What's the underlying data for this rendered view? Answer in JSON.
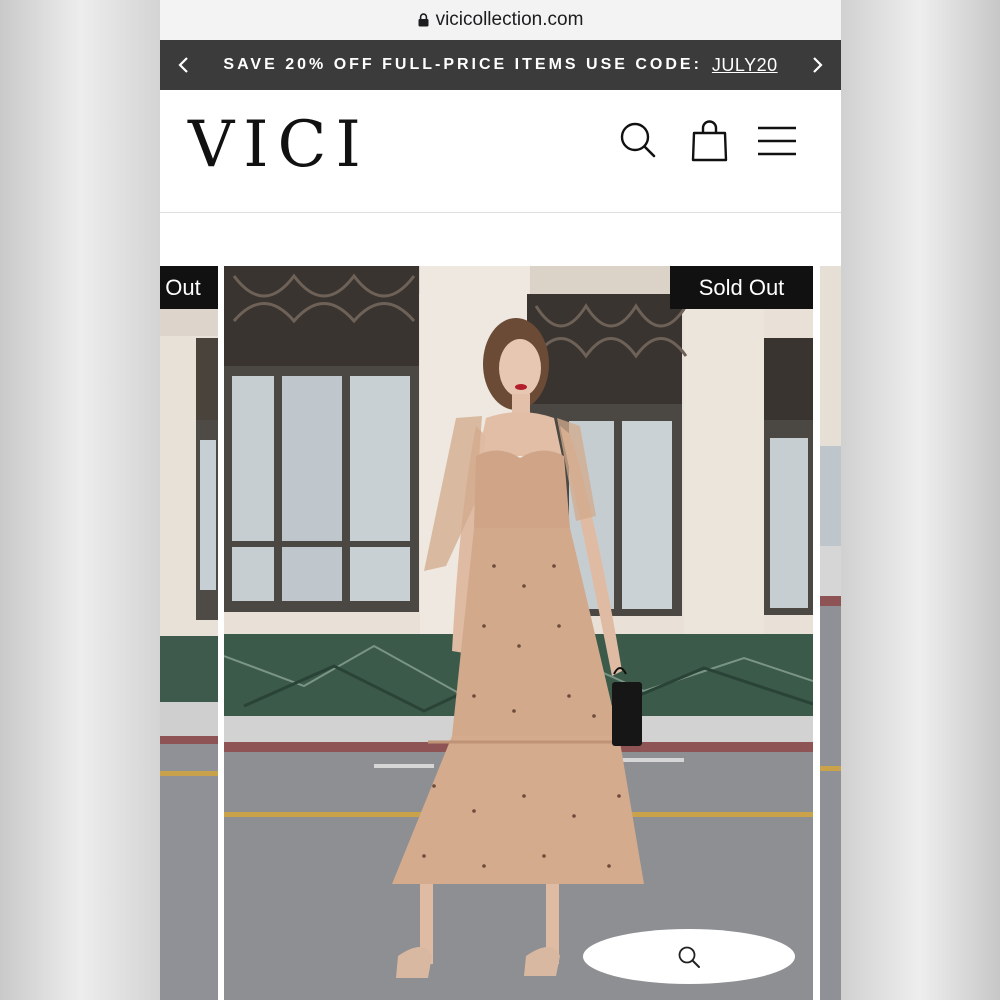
{
  "browser": {
    "url": "vicicollection.com"
  },
  "promo": {
    "text": "SAVE 20% OFF FULL-PRICE ITEMS USE CODE:",
    "code": "JULY20",
    "prev_icon": "chevron-left-icon",
    "next_icon": "chevron-right-icon"
  },
  "header": {
    "logo": "VICI",
    "icons": [
      "search-icon",
      "shopping-bag-icon",
      "hamburger-menu-icon"
    ]
  },
  "gallery": {
    "main_badge": "Sold Out",
    "prev_badge": "Out",
    "zoom_icon": "search-icon"
  },
  "colors": {
    "promo_bg": "#3b3b3b",
    "badge_bg": "#111111",
    "dress": "#d2a98b",
    "marble": "#3b5a4a"
  }
}
